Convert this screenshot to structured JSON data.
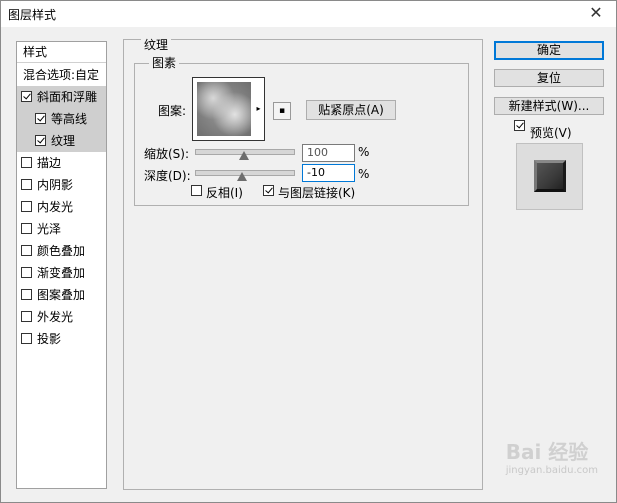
{
  "window": {
    "title": "图层样式",
    "close_glyph": "✕"
  },
  "styles_list": {
    "header": "样式",
    "blend_options": "混合选项:自定",
    "items": [
      {
        "label": "斜面和浮雕",
        "checked": true,
        "selected": true,
        "indent": false
      },
      {
        "label": "等高线",
        "checked": true,
        "selected": true,
        "indent": true
      },
      {
        "label": "纹理",
        "checked": true,
        "selected": true,
        "indent": true
      },
      {
        "label": "描边",
        "checked": false,
        "selected": false,
        "indent": false
      },
      {
        "label": "内阴影",
        "checked": false,
        "selected": false,
        "indent": false
      },
      {
        "label": "内发光",
        "checked": false,
        "selected": false,
        "indent": false
      },
      {
        "label": "光泽",
        "checked": false,
        "selected": false,
        "indent": false
      },
      {
        "label": "颜色叠加",
        "checked": false,
        "selected": false,
        "indent": false
      },
      {
        "label": "渐变叠加",
        "checked": false,
        "selected": false,
        "indent": false
      },
      {
        "label": "图案叠加",
        "checked": false,
        "selected": false,
        "indent": false
      },
      {
        "label": "外发光",
        "checked": false,
        "selected": false,
        "indent": false
      },
      {
        "label": "投影",
        "checked": false,
        "selected": false,
        "indent": false
      }
    ]
  },
  "texture": {
    "section_title": "纹理",
    "group_title": "图素",
    "pattern_label": "图案:",
    "snap_button": "贴紧原点(A)",
    "scale_label": "缩放(S):",
    "scale_value": "100",
    "scale_fraction": 0.5,
    "depth_label": "深度(D):",
    "depth_value": "-10",
    "depth_fraction": 0.48,
    "percent": "%",
    "invert_label": "反相(I)",
    "invert_checked": false,
    "link_label": "与图层链接(K)",
    "link_checked": true
  },
  "buttons": {
    "ok": "确定",
    "reset": "复位",
    "new_style": "新建样式(W)..."
  },
  "preview": {
    "label": "预览(V)",
    "checked": true
  },
  "watermark": {
    "brand": "Bai 经验",
    "url": "jingyan.baidu.com"
  },
  "icons": {
    "dropdown": "▸",
    "pattern_menu": "▪"
  }
}
